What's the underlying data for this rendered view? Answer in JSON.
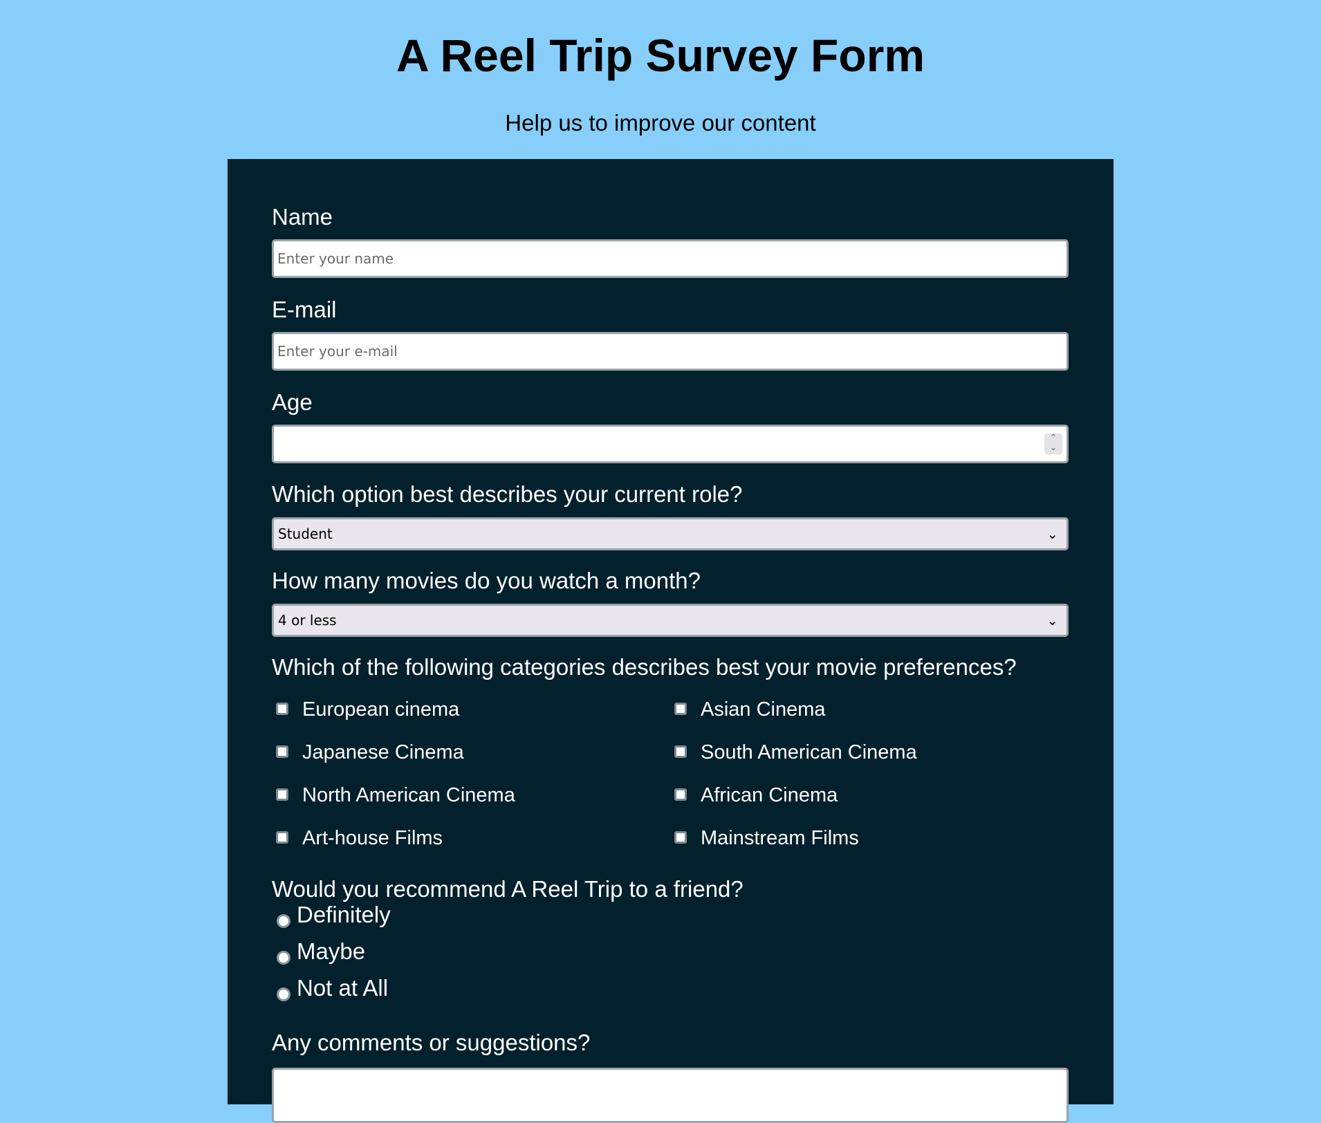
{
  "header": {
    "title": "A Reel Trip Survey Form",
    "subtitle": "Help us to improve our content"
  },
  "form": {
    "name": {
      "label": "Name",
      "placeholder": "Enter your name"
    },
    "email": {
      "label": "E-mail",
      "placeholder": "Enter your e-mail"
    },
    "age": {
      "label": "Age",
      "value": ""
    },
    "role": {
      "label": "Which option best describes your current role?",
      "selected": "Student"
    },
    "movies": {
      "label": "How many movies do you watch a month?",
      "selected": "4 or less"
    },
    "categories": {
      "label": "Which of the following categories describes best your movie preferences?",
      "options": [
        {
          "label": "European cinema",
          "checked": false
        },
        {
          "label": "Asian Cinema",
          "checked": false
        },
        {
          "label": "Japanese Cinema",
          "checked": false
        },
        {
          "label": "South American Cinema",
          "checked": false
        },
        {
          "label": "North American Cinema",
          "checked": false
        },
        {
          "label": "African Cinema",
          "checked": false
        },
        {
          "label": "Art-house Films",
          "checked": false
        },
        {
          "label": "Mainstream Films",
          "checked": false
        }
      ]
    },
    "recommend": {
      "label": "Would you recommend A Reel Trip to a friend?",
      "options": [
        {
          "label": "Definitely",
          "checked": false
        },
        {
          "label": "Maybe",
          "checked": false
        },
        {
          "label": "Not at All",
          "checked": false
        }
      ]
    },
    "comments": {
      "label": "Any comments or suggestions?",
      "value": ""
    }
  },
  "colors": {
    "page_background": "#87cefa",
    "form_background": "#03202d",
    "label_text": "#ffffff"
  }
}
